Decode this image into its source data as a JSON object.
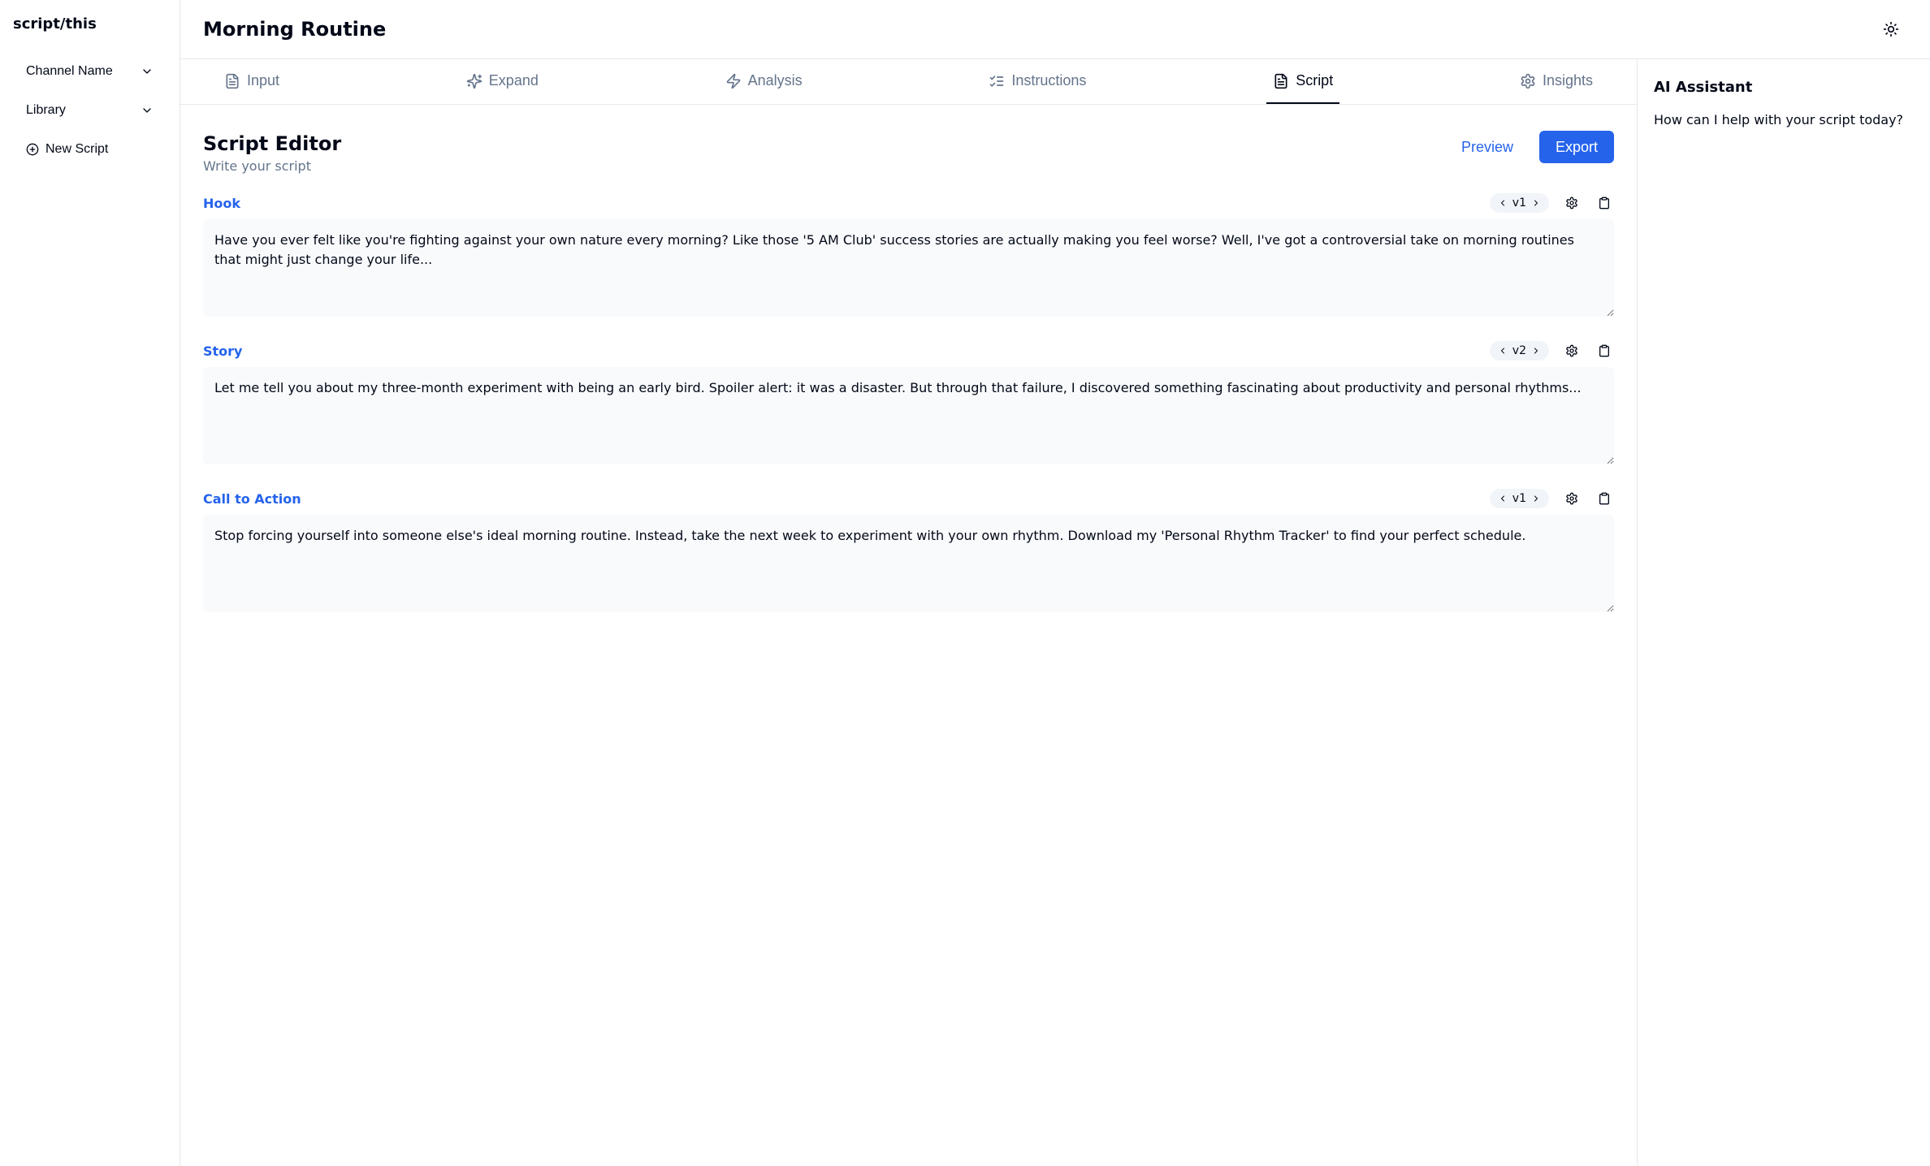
{
  "brand": "script/this",
  "sidebar": {
    "channel_label": "Channel Name",
    "library_label": "Library",
    "new_script_label": "New Script"
  },
  "header": {
    "title": "Morning Routine"
  },
  "tabs": [
    {
      "id": "input",
      "label": "Input",
      "icon": "file-text-icon",
      "active": false
    },
    {
      "id": "expand",
      "label": "Expand",
      "icon": "sparkles-icon",
      "active": false
    },
    {
      "id": "analysis",
      "label": "Analysis",
      "icon": "zap-icon",
      "active": false
    },
    {
      "id": "instructions",
      "label": "Instructions",
      "icon": "list-checks-icon",
      "active": false
    },
    {
      "id": "script",
      "label": "Script",
      "icon": "file-text-icon",
      "active": true
    },
    {
      "id": "insights",
      "label": "Insights",
      "icon": "settings-icon",
      "active": false
    }
  ],
  "editor": {
    "heading": "Script Editor",
    "subheading": "Write your script",
    "preview_label": "Preview",
    "export_label": "Export"
  },
  "sections": [
    {
      "title": "Hook",
      "version": "v1",
      "content": "Have you ever felt like you're fighting against your own nature every morning? Like those '5 AM Club' success stories are actually making you feel worse? Well, I've got a controversial take on morning routines that might just change your life..."
    },
    {
      "title": "Story",
      "version": "v2",
      "content": "Let me tell you about my three-month experiment with being an early bird. Spoiler alert: it was a disaster. But through that failure, I discovered something fascinating about productivity and personal rhythms..."
    },
    {
      "title": "Call to Action",
      "version": "v1",
      "content": "Stop forcing yourself into someone else's ideal morning routine. Instead, take the next week to experiment with your own rhythm. Download my 'Personal Rhythm Tracker' to find your perfect schedule."
    }
  ],
  "assistant": {
    "title": "AI Assistant",
    "message": "How can I help with your script today?"
  }
}
